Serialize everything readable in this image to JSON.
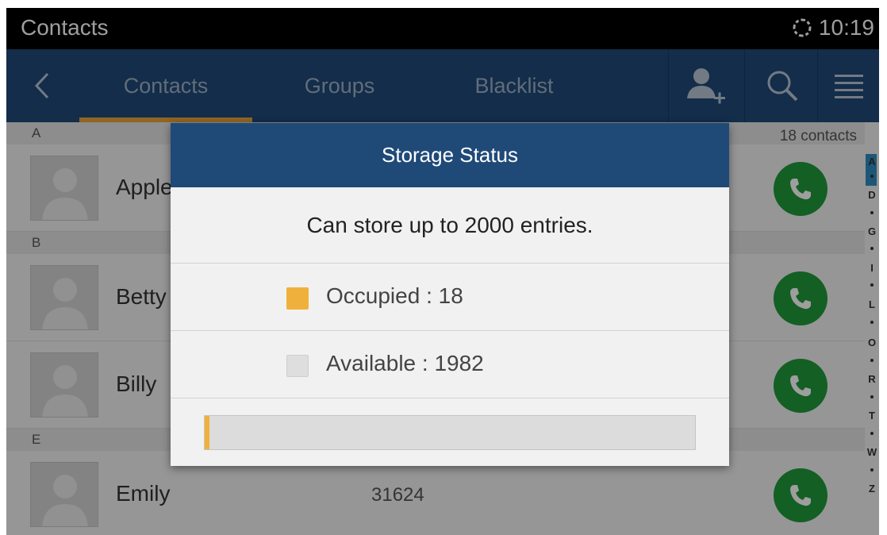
{
  "status_bar": {
    "title": "Contacts",
    "time": "10:19"
  },
  "tabs": [
    {
      "label": "Contacts",
      "active": true
    },
    {
      "label": "Groups",
      "active": false
    },
    {
      "label": "Blacklist",
      "active": false
    }
  ],
  "toolbar_icons": [
    "back-arrow-icon",
    "add-contact-icon",
    "search-icon",
    "menu-icon"
  ],
  "contacts_count": "18 contacts",
  "sections": [
    {
      "letter": "A",
      "contacts": [
        {
          "name": "Apple",
          "number": ""
        }
      ]
    },
    {
      "letter": "B",
      "contacts": [
        {
          "name": "Betty",
          "number": ""
        },
        {
          "name": "Billy",
          "number": ""
        }
      ]
    },
    {
      "letter": "E",
      "contacts": [
        {
          "name": "Emily",
          "number": "31624"
        }
      ]
    }
  ],
  "index_letters": [
    "A",
    "D",
    "G",
    "I",
    "L",
    "O",
    "R",
    "T",
    "W",
    "Z"
  ],
  "dialog": {
    "title": "Storage Status",
    "message": "Can store up to 2000 entries.",
    "occupied": {
      "label": "Occupied",
      "value": "18",
      "color": "#f0b13c"
    },
    "available": {
      "label": "Available",
      "value": "1982",
      "color": "#dedede"
    },
    "capacity": 2000,
    "used_fraction": 0.009
  },
  "colors": {
    "action_bar": "#1f4a78",
    "tab_indicator": "#e7a33a",
    "call_button": "#1f9a3a"
  }
}
